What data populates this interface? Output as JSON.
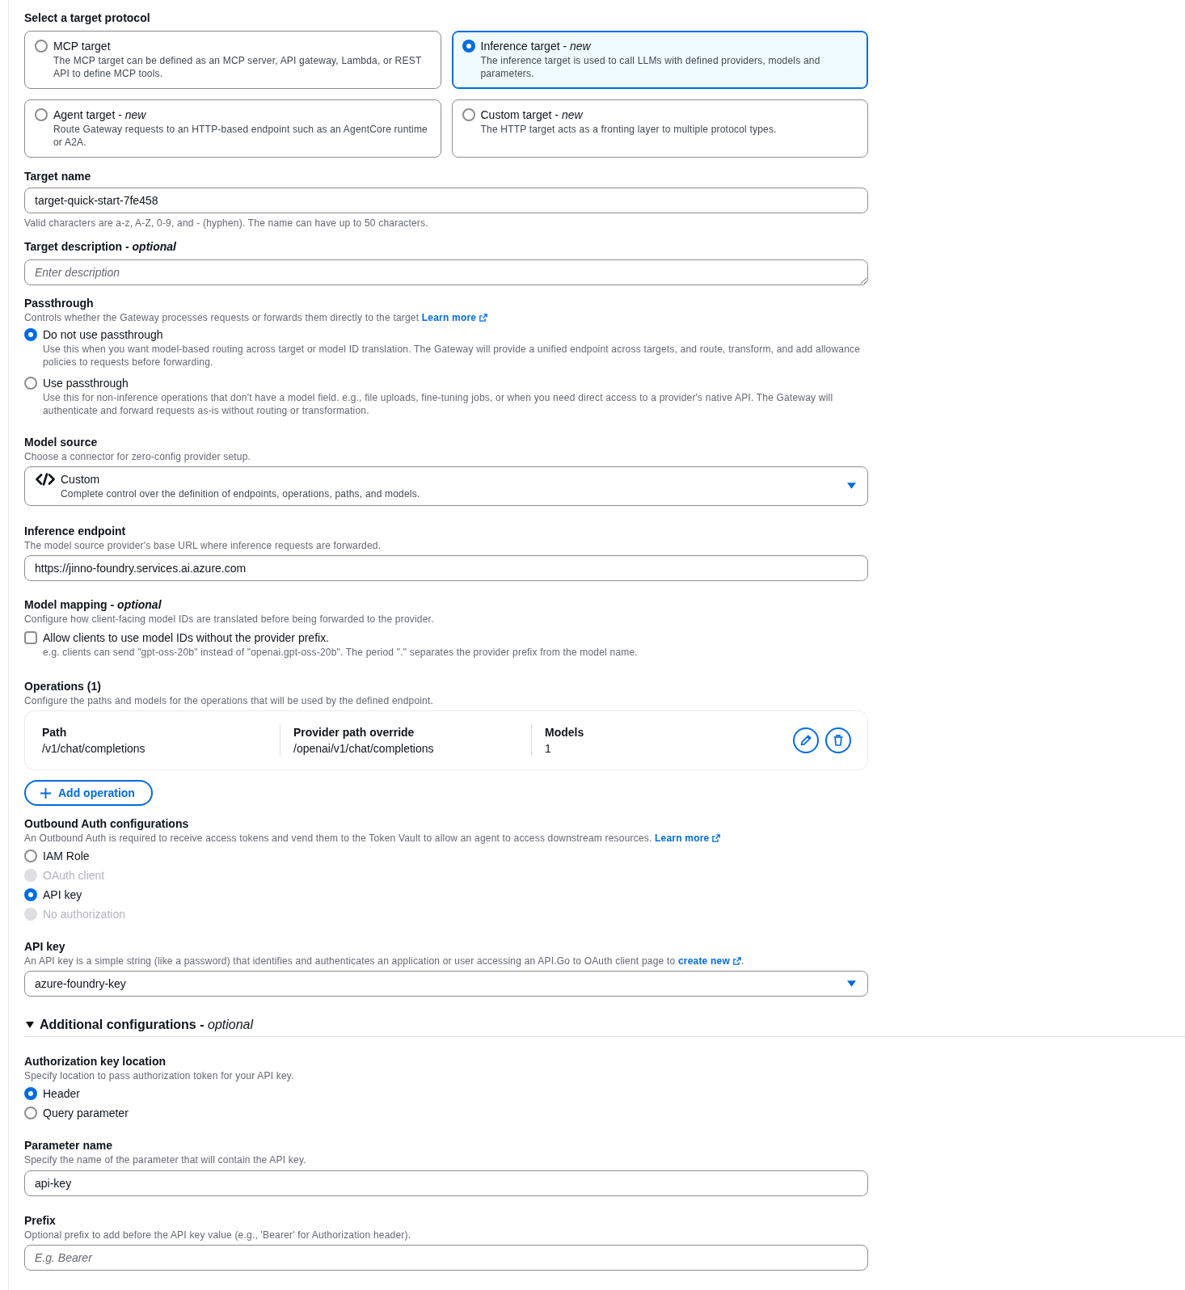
{
  "target_protocol": {
    "label": "Select a target protocol",
    "options": [
      {
        "title": "MCP target",
        "description": "The MCP target can be defined as an MCP server, API gateway, Lambda, or REST API to define MCP tools.",
        "selected": false
      },
      {
        "title": "Inference target - *new*",
        "description": "The inference target is used to call LLMs with defined providers, models and parameters.",
        "selected": true
      },
      {
        "title": "Agent target - *new*",
        "description": "Route Gateway requests to an HTTP-based endpoint such as an AgentCore runtime or A2A.",
        "selected": false
      },
      {
        "title": "Custom target - *new*",
        "description": "The HTTP target acts as a fronting layer to multiple protocol types.",
        "selected": false
      }
    ]
  },
  "target_name": {
    "label": "Target name",
    "value": "target-quick-start-7fe458",
    "hint": "Valid characters are a-z, A-Z, 0-9, and - (hyphen). The name can have up to 50 characters."
  },
  "target_description": {
    "label": "Target description - *optional*",
    "placeholder": "Enter description"
  },
  "passthrough": {
    "label": "Passthrough",
    "description": {
      "text": "Controls whether the Gateway processes requests or forwards them directly to the target",
      "link": "Learn more"
    },
    "options": [
      {
        "label": "Do not use passthrough",
        "description": "Use this when you want model-based routing across target or model ID translation. The Gateway will provide a unified endpoint across targets, and route, transform, and add allowance policies to requests before forwarding.",
        "selected": true
      },
      {
        "label": "Use passthrough",
        "description": "Use this for non-inference operations that don't have a model field. e.g., file uploads, fine-tuning jobs, or when you need direct access to a provider's native API. The Gateway will authenticate and forward requests as-is without routing or transformation.",
        "selected": false
      }
    ]
  },
  "model_source": {
    "label": "Model source",
    "description": "Choose a connector for zero-config provider setup.",
    "select": {
      "value": "Custom",
      "description": "Complete control over the definition of endpoints, operations, paths, and models."
    }
  },
  "inference_endpoint": {
    "label": "Inference endpoint",
    "description": "The model source provider's base URL where inference requests are forwarded.",
    "value": "https://jinno-foundry.services.ai.azure.com"
  },
  "model_mapping": {
    "label": "Model mapping - *optional*",
    "description": "Configure how client-facing model IDs are translated before being forwarded to the provider.",
    "checkbox": {
      "label": "Allow clients to use model IDs without the provider prefix.",
      "hint": "e.g. clients can send \"gpt-oss-20b\" instead of \"openai.gpt-oss-20b\". The period \".\" separates the provider prefix from the model name.",
      "checked": false
    }
  },
  "operations": {
    "title": "Operations (1)",
    "description": "Configure the paths and models for the operations that will be used by the defined endpoint.",
    "columns": [
      "Path",
      "Provider path override",
      "Models"
    ],
    "rows": [
      [
        "/v1/chat/completions",
        "/openai/v1/chat/completions",
        "1"
      ]
    ],
    "add_button": "Add operation"
  },
  "outbound_auth": {
    "label": "Outbound Auth configurations",
    "description": {
      "text": "An Outbound Auth is required to receive access tokens and vend them to the Token Vault to allow an agent to access downstream resources.",
      "link": "Learn more"
    },
    "options": [
      {
        "label": "IAM Role",
        "selected": false,
        "disabled": false
      },
      {
        "label": "OAuth client",
        "selected": false,
        "disabled": true
      },
      {
        "label": "API key",
        "selected": true,
        "disabled": false
      },
      {
        "label": "No authorization",
        "selected": false,
        "disabled": true
      }
    ]
  },
  "api_key": {
    "label": "API key",
    "description": {
      "text": "An API key is a simple string (like a password) that identifies and authenticates an application or user accessing an API.Go to OAuth client page to",
      "link": "create new",
      "text_after": "."
    },
    "value": "azure-foundry-key"
  },
  "additional_configurations": {
    "title": "Additional configurations - *optional*",
    "expanded": true,
    "auth_key_location": {
      "label": "Authorization key location",
      "description": "Specify location to pass authorization token for your API key.",
      "options": [
        {
          "label": "Header",
          "selected": true
        },
        {
          "label": "Query parameter",
          "selected": false
        }
      ]
    },
    "parameter_name": {
      "label": "Parameter name",
      "description": "Specify the name of the parameter that will contain the API key.",
      "value": "api-key"
    },
    "prefix": {
      "label": "Prefix",
      "description": "Optional prefix to add before the API key value (e.g., 'Bearer' for Authorization header).",
      "placeholder": "E.g. Bearer"
    }
  }
}
